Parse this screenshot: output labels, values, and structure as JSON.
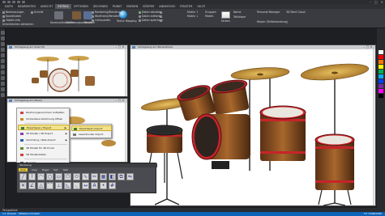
{
  "menubar": {
    "items": [
      "DATEI",
      "BEARBEITEN",
      "ANSICHT",
      "EXTRAS",
      "OPTIONEN",
      "ZEICHNEN",
      "PUNKT",
      "EBENEN",
      "KÖRPER",
      "ANIMATION",
      "FENSTER",
      "HILFE"
    ],
    "active_index": 3
  },
  "ribbon": {
    "left_items": [
      "Bemessungen",
      "Koordinaten",
      "Objekt-Info",
      "Schnitt",
      "Unterdrücken aktivieren"
    ],
    "mid_items": [
      "Konstruktionshilfen",
      "Zeichnungsoptionen",
      "Rendern"
    ],
    "render_options": [
      "Rendering/Blending",
      "Wireframe/Rendern",
      "Lichtquellen"
    ],
    "render_mode_label": "Textur Mapping",
    "right_opts": [
      "Daten abrufen",
      "Daten editieren",
      "Daten speichern"
    ],
    "matrix": [
      "Matrix ↑",
      "Matrix ↓"
    ],
    "buttons": [
      "Gruppen",
      "Materi.",
      "Farben"
    ],
    "dropdowns": [
      "Name",
      "Teilkörper"
    ],
    "manager": "Personal Manager",
    "pointcloud": "3D Point Cloud",
    "extra": "Körper (Teilbehandlung)"
  },
  "windows": [
    {
      "title": "Schlagzeug.wrl (Ansicht)"
    },
    {
      "title": "Schlagzeug.wrl (Oben)"
    },
    {
      "title": "Schlagzeug.wrl (Perspektive)"
    }
  ],
  "context_menu": {
    "items": [
      {
        "label": "Zeichnungsnummern enthalten",
        "icon_color": "#c44"
      },
      {
        "label": "Vorhandene Zeichnung öffnen",
        "icon_color": "#c98a2a"
      },
      {
        "label": "Exportieren / Export",
        "icon_color": "#2f7d3a",
        "submenu": true,
        "highlighted": true
      },
      {
        "label": "3D Modell / 3D Export",
        "icon_color": "#8a3fb0",
        "submenu": true
      },
      {
        "label": "Sammlung / Web-Import",
        "icon_color": "#2a5fb0",
        "submenu": true
      },
      {
        "label": "3D Modell für 3D Druck",
        "icon_color": "#5a8a2a"
      },
      {
        "label": "3D Modell-Daten",
        "icon_color": "#c44"
      },
      {
        "label": "Beenden",
        "icon_color": "#555"
      }
    ]
  },
  "submenu": {
    "items": [
      "Exportieren Import",
      "Laserdrucker Import"
    ],
    "highlighted_index": 0
  },
  "palette": {
    "title": "Werkzeug",
    "tabs": [
      "Linie",
      "Kreis",
      "Bogen",
      "Text",
      "Maß"
    ],
    "active_tab": 0
  },
  "tabbar": {
    "label": "Perspektive"
  },
  "status": {
    "left": "1:1 Dreieck · Mittelkoordinaten",
    "right": "TP: STANDARD"
  },
  "colors": {
    "accent": "#0e64b8",
    "highlight": "#f2e38a",
    "palette_colors": [
      "#ffffff",
      "#ff0000",
      "#ff7700",
      "#ffff00",
      "#00b050",
      "#00b0f0",
      "#0040ff",
      "#7030a0",
      "#ff00ff",
      "#000000"
    ]
  }
}
